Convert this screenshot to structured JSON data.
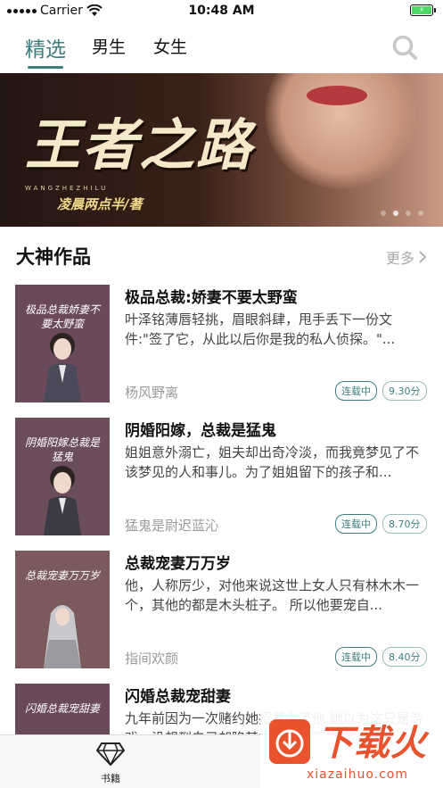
{
  "status_bar": {
    "carrier": "Carrier",
    "time": "10:48 AM",
    "battery_level_percent": 100
  },
  "top_tabs": {
    "items": [
      {
        "label": "精选",
        "active": true
      },
      {
        "label": "男生",
        "active": false
      },
      {
        "label": "女生",
        "active": false
      }
    ],
    "search_icon": "search-icon"
  },
  "banner": {
    "title": "王者之路",
    "tagline": "WANGZHEZHILU",
    "author_line": "凌晨两点半/著",
    "page_count": 4,
    "active_page": 1
  },
  "section": {
    "title": "大神作品",
    "more_label": "更多"
  },
  "books": [
    {
      "title": "极品总裁:娇妻不要太野蛮",
      "description": "叶泽铭薄唇轻挑，眉眼斜肆，甩手丢下一份文件:\"签了它，从此以后你是我的私人侦探。\"...",
      "author": "杨风野离",
      "status": "连载中",
      "score": "9.30分",
      "cover_text": "极品总裁娇妻不要太野蛮",
      "cover_color": "#6a4a5a"
    },
    {
      "title": "阴婚阳嫁，总裁是猛鬼",
      "description": "姐姐意外溺亡，姐夫却出奇冷淡，而我竟梦见了不该梦见的人和事儿。为了姐姐留下的孩子和...",
      "author": "猛鬼是尉迟蓝沁",
      "status": "连载中",
      "score": "8.70分",
      "cover_text": "阴婚阳嫁总裁是猛鬼",
      "cover_color": "#6b4d5c"
    },
    {
      "title": "总裁宠妻万万岁",
      "description": "他，人称厉少，对他来说这世上女人只有林木木一个，其他的都是木头桩子。 所以他要宠自...",
      "author": "指间欢颜",
      "status": "连载中",
      "score": "8.40分",
      "cover_text": "总裁宠妻万万岁",
      "cover_color": "#7a5a5a"
    },
    {
      "title": "闪婚总裁宠甜妻",
      "description": "九年前因为一次赌约她招惹上了他 她以为这只是游戏，没想到自己却陷其中，而即便如此...",
      "author": "",
      "status": "",
      "score": "",
      "cover_text": "闪婚总裁宠甜妻",
      "cover_color": "#6a4a5a"
    }
  ],
  "tab_bar": {
    "items": [
      {
        "label": "书籍",
        "icon": "diamond-icon"
      }
    ]
  },
  "watermark": {
    "text": "下载火",
    "url": "xiazaihuo.com"
  },
  "colors": {
    "accent": "#3d7d7d",
    "muted": "#9a9a9a",
    "watermark": "#e8532e"
  }
}
